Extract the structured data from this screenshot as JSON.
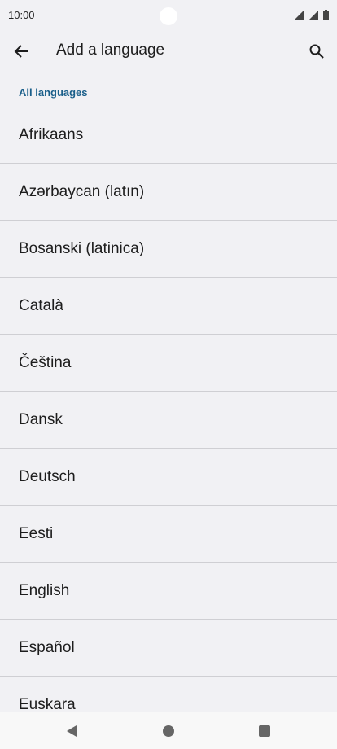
{
  "status_bar": {
    "time": "10:00",
    "icons": [
      "signal-icon",
      "signal-icon",
      "battery-icon"
    ]
  },
  "app_bar": {
    "title": "Add a language",
    "back_icon": "arrow-back-icon",
    "search_icon": "search-icon"
  },
  "section": {
    "header": "All languages"
  },
  "languages": [
    "Afrikaans",
    "Azərbaycan (latın)",
    "Bosanski (latinica)",
    "Català",
    "Čeština",
    "Dansk",
    "Deutsch",
    "Eesti",
    "English",
    "Español",
    "Euskara"
  ],
  "nav_bar": {
    "icons": [
      "back-triangle-icon",
      "home-circle-icon",
      "recents-square-icon"
    ]
  },
  "colors": {
    "background": "#f1f1f4",
    "accent": "#1a5f8a",
    "divider": "#cfcfd3"
  }
}
